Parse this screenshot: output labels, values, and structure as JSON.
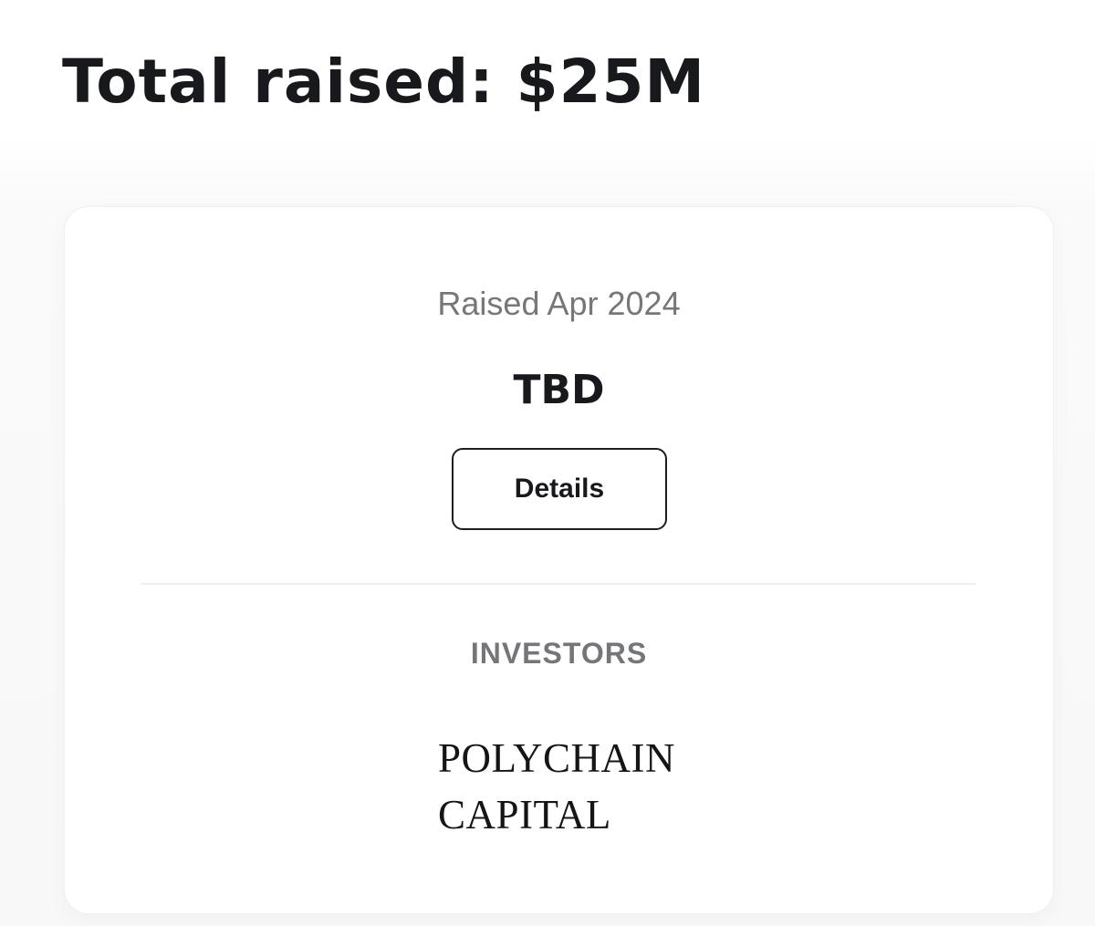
{
  "header": {
    "title": "Total raised: $25M"
  },
  "round": {
    "raised_date": "Raised Apr 2024",
    "amount": "TBD",
    "details_label": "Details"
  },
  "investors": {
    "heading": "INVESTORS",
    "items": [
      {
        "name_line1": "POLYCHAIN",
        "name_line2": "CAPITAL"
      }
    ]
  }
}
